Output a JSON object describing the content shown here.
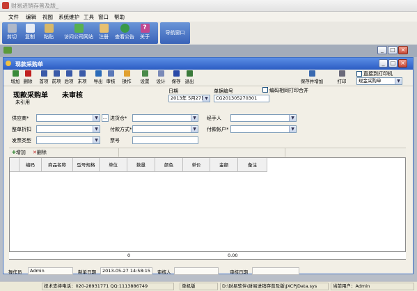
{
  "app": {
    "title": "财易进销存普及版_"
  },
  "menu": [
    "文件",
    "编辑",
    "视图",
    "系统维护",
    "工具",
    "窗口",
    "帮助"
  ],
  "toolbar": [
    {
      "label": "剪切",
      "icon": "scissors-icon",
      "color": "#b0b8c8"
    },
    {
      "label": "复制",
      "icon": "copy-icon",
      "color": "#e8ecf4"
    },
    {
      "label": "粘贴",
      "icon": "paste-icon",
      "color": "#d8b868"
    },
    {
      "label": "访问公司网站",
      "icon": "home-icon",
      "color": "#58b050"
    },
    {
      "label": "注册",
      "icon": "register-icon",
      "color": "#e8c070"
    },
    {
      "label": "查看公告",
      "icon": "globe-icon",
      "color": "#3a9a48"
    },
    {
      "label": "关于",
      "icon": "question-icon",
      "color": "#c04890"
    }
  ],
  "toolbar2": {
    "label": "导航窗口"
  },
  "window": {
    "title": "现款采购单"
  },
  "child_toolbar": [
    {
      "label": "增加",
      "icon": "add-icon",
      "color": "#3a8a3a"
    },
    {
      "label": "删除",
      "icon": "delete-icon",
      "color": "#c02020"
    },
    {
      "label": "首项",
      "icon": "first-icon",
      "color": "#3a5aa8"
    },
    {
      "label": "前项",
      "icon": "prev-icon",
      "color": "#3a5aa8"
    },
    {
      "label": "后项",
      "icon": "next-icon",
      "color": "#3a5aa8"
    },
    {
      "label": "末项",
      "icon": "last-icon",
      "color": "#3a5aa8"
    },
    {
      "label": "导出",
      "icon": "export-icon",
      "color": "#2a6ab8"
    },
    {
      "label": "审核",
      "icon": "audit-icon",
      "color": "#5a78b8"
    },
    {
      "label": "操作",
      "icon": "operate-icon",
      "color": "#e0a030"
    },
    {
      "label": "设置",
      "icon": "settings-icon",
      "color": "#4a8a4a"
    },
    {
      "label": "设计",
      "icon": "design-icon",
      "color": "#7a8ab8"
    },
    {
      "label": "保存",
      "icon": "save-icon",
      "color": "#2a4aa8"
    },
    {
      "label": "退出",
      "icon": "exit-icon",
      "color": "#3a7a3a"
    },
    {
      "label": "保存并增加",
      "icon": "save-add-icon",
      "color": "#3a6ab0"
    },
    {
      "label": "打印",
      "icon": "print-icon",
      "color": "#6a6a7a"
    }
  ],
  "print_options": {
    "direct_label": "直接到打印机",
    "selected": "现金采购单"
  },
  "form": {
    "title": "现款采购单",
    "status": "未审核",
    "ref_status": "未引用",
    "date_label": "日期",
    "date_value": "2013年 5月27日",
    "doc_no_label": "单据编号",
    "doc_no_value": "CG201305270301",
    "merge_print_label": "编码相同打印合并",
    "supplier_label": "供应商*",
    "warehouse_label": "进货仓*",
    "handler_label": "经手人",
    "discount_label": "整单折扣",
    "pay_method_label": "付款方式*",
    "pay_account_label": "付款帐户*",
    "invoice_type_label": "发票类型",
    "ticket_no_label": "票号"
  },
  "grid": {
    "add_label": "增加",
    "delete_label": "删除",
    "columns": [
      "编码",
      "商品名称",
      "型号规格",
      "单位",
      "数量",
      "颜色",
      "单价",
      "金额",
      "备注"
    ],
    "sum_qty": "0",
    "sum_amount": "0.00"
  },
  "footer": {
    "operator_label": "操作员",
    "operator_value": "Admin",
    "make_date_label": "制单日期",
    "make_date_value": "2013-05-27 14:58:15",
    "auditor_label": "审核人",
    "audit_date_label": "审核日期"
  },
  "statusbar": {
    "support": "技术支持电话：020-28931771 QQ:1113886749",
    "edition": "单机版",
    "path": "D:\\财易软件\\财易进销存普及版\\JXCPJData.sys",
    "user": "当前用户：Admin"
  }
}
